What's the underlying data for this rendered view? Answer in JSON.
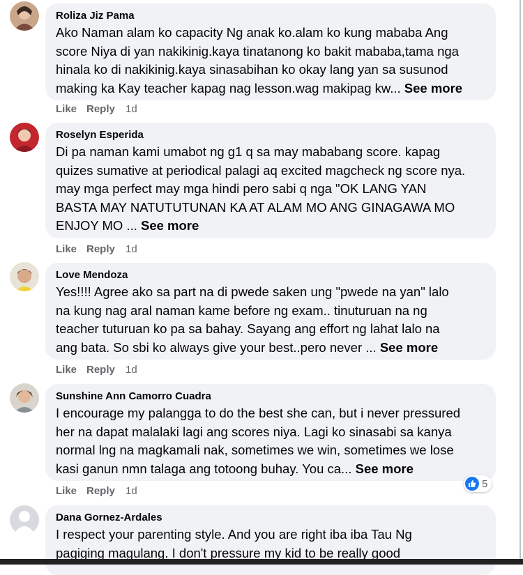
{
  "comments": [
    {
      "author": "Roliza Jiz Pama",
      "text": "Ako Naman alam ko capacity Ng anak ko.alam ko kung mababa Ang\nscore Niya di yan nakikinig.kaya tinatanong ko bakit mababa,tama nga\nhinala ko di nakikinig.kaya sinasabihan ko okay lang yan sa susunod\nmaking ka Kay teacher kapag nag lesson.wag makipag kw...",
      "see_more": "See more",
      "like": "Like",
      "reply": "Reply",
      "time": "1d"
    },
    {
      "author": "Roselyn Esperida",
      "text": "Di pa naman kami umabot ng g1 q sa may mababang score. kapag\nquizes sumative at periodical palagi aq excited magcheck ng score nya.\nmay mga perfect may mga hindi pero sabi q nga \"OK LANG YAN\nBASTA MAY NATUTUTUNAN KA AT ALAM MO ANG GINAGAWA MO\nENJOY MO ...",
      "see_more": "See more",
      "like": "Like",
      "reply": "Reply",
      "time": "1d"
    },
    {
      "author": "Love Mendoza",
      "text": "Yes!!!! Agree ako sa part na di pwede saken ung \"pwede na yan\" lalo\nna kung nag aral naman kame before ng exam.. tinuturuan na ng\nteacher tuturuan ko pa sa bahay. Sayang ang effort ng lahat lalo na\nang bata. So sbi ko always give your best..pero never ...",
      "see_more": "See more",
      "like": "Like",
      "reply": "Reply",
      "time": "1d"
    },
    {
      "author": "Sunshine Ann Camorro Cuadra",
      "text": "I encourage my palangga to do the best she can, but i never pressured\nher na dapat malalaki lagi ang scores niya. Lagi ko sinasabi sa kanya\nnormal lng na magkamali nak, sometimes we win, sometimes we lose\nkasi ganun nmn talaga ang totoong buhay. You ca...",
      "see_more": "See more",
      "like": "Like",
      "reply": "Reply",
      "time": "1d",
      "reaction_count": "5"
    },
    {
      "author": "Dana Gornez-Ardales",
      "text": "I respect your parenting style. And you are right iba iba Tau Ng\npagiging magulang. I don't pressure my kid to be really good"
    }
  ],
  "colors": {
    "bubble": "#f0f2f5",
    "secondary_text": "#65676b",
    "like_blue": "#1877f2"
  }
}
